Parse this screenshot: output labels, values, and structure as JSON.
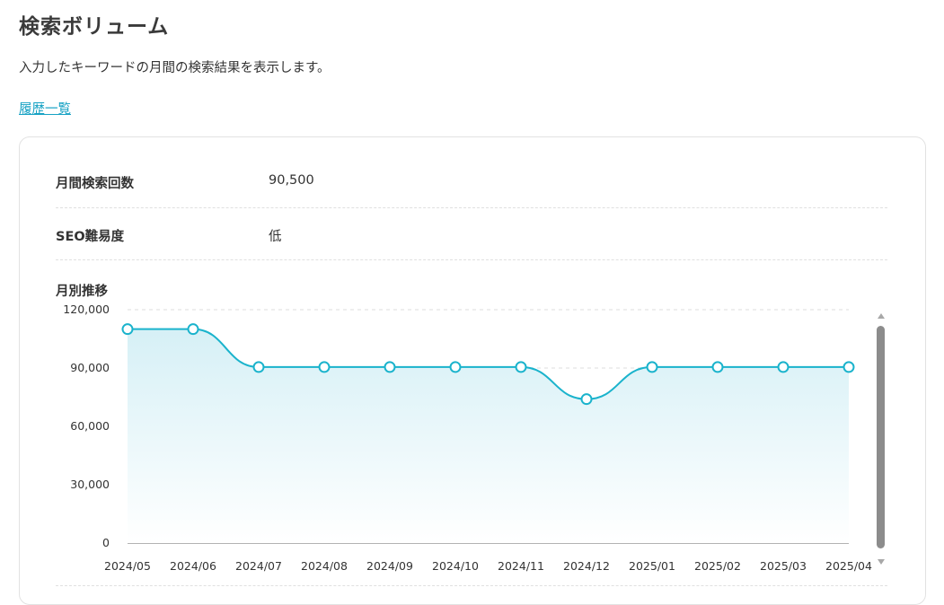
{
  "page": {
    "title": "検索ボリューム",
    "description": "入力したキーワードの月間の検索結果を表示します。",
    "history_link": "履歴一覧"
  },
  "metrics": [
    {
      "label": "月間検索回数",
      "value": "90,500"
    },
    {
      "label": "SEO難易度",
      "value": "低"
    }
  ],
  "chart_section_label": "月別推移",
  "colors": {
    "accent": "#17a2c4",
    "line": "#1ab3cc",
    "area_top": "#d6f0f6"
  },
  "chart_data": {
    "type": "area",
    "x": [
      "2024/05",
      "2024/06",
      "2024/07",
      "2024/08",
      "2024/09",
      "2024/10",
      "2024/11",
      "2024/12",
      "2025/01",
      "2025/02",
      "2025/03",
      "2025/04"
    ],
    "series": [
      {
        "values": [
          110000,
          110000,
          90500,
          90500,
          90500,
          90500,
          90500,
          74000,
          90500,
          90500,
          90500,
          90500
        ]
      }
    ],
    "y_ticks": [
      "0",
      "30,000",
      "60,000",
      "90,000",
      "120,000"
    ],
    "y_tick_values": [
      0,
      30000,
      60000,
      90000,
      120000
    ],
    "ylim": [
      0,
      120000
    ],
    "grid": true,
    "smooth": true
  }
}
